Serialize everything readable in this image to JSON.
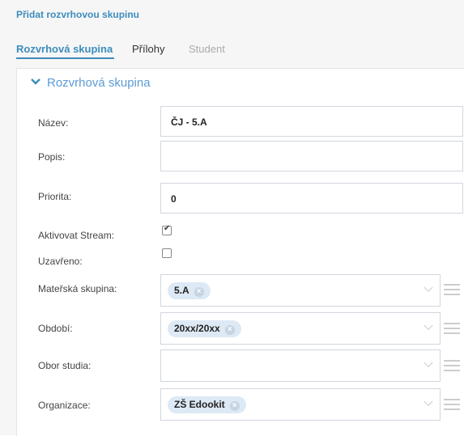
{
  "header": {
    "title": "Přidat rozvrhovou skupinu"
  },
  "tabs": [
    {
      "label": "Rozvrhová skupina"
    },
    {
      "label": "Přílohy"
    },
    {
      "label": "Student"
    }
  ],
  "section": {
    "title": "Rozvrhová skupina"
  },
  "form": {
    "name": {
      "label": "Název:",
      "value": "ČJ  - 5.A"
    },
    "description": {
      "label": "Popis:",
      "value": ""
    },
    "priority": {
      "label": "Priorita:",
      "value": "0"
    },
    "activate_stream": {
      "label": "Aktivovat Stream:",
      "checked": true
    },
    "closed": {
      "label": "Uzavřeno:",
      "checked": false
    },
    "parent_group": {
      "label": "Mateřská skupina:",
      "tag": "5.A"
    },
    "period": {
      "label": "Období:",
      "tag": "20xx/20xx"
    },
    "field_of_study": {
      "label": "Obor studia:",
      "tag": ""
    },
    "organization": {
      "label": "Organizace:",
      "tag": "ZŠ Edookit"
    }
  },
  "icons": {
    "remove": "×",
    "caret": "chevron-down-icon",
    "menu": "hamburger-icon"
  },
  "colors": {
    "accent": "#3c8dbc",
    "tag_bg": "#dde9f5"
  }
}
